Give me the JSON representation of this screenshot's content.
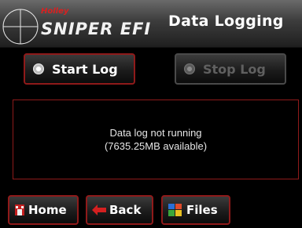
{
  "header": {
    "brand": "Holley",
    "logo_text": "SNIPER EFI",
    "title": "Data Logging"
  },
  "controls": {
    "start_label": "Start Log",
    "stop_label": "Stop Log"
  },
  "status": {
    "line1": "Data log not running",
    "line2": "(7635.25MB available)"
  },
  "nav": {
    "home_label": "Home",
    "back_label": "Back",
    "files_label": "Files"
  },
  "colors": {
    "accent_red": "#8f1a1a",
    "background": "#000000"
  }
}
